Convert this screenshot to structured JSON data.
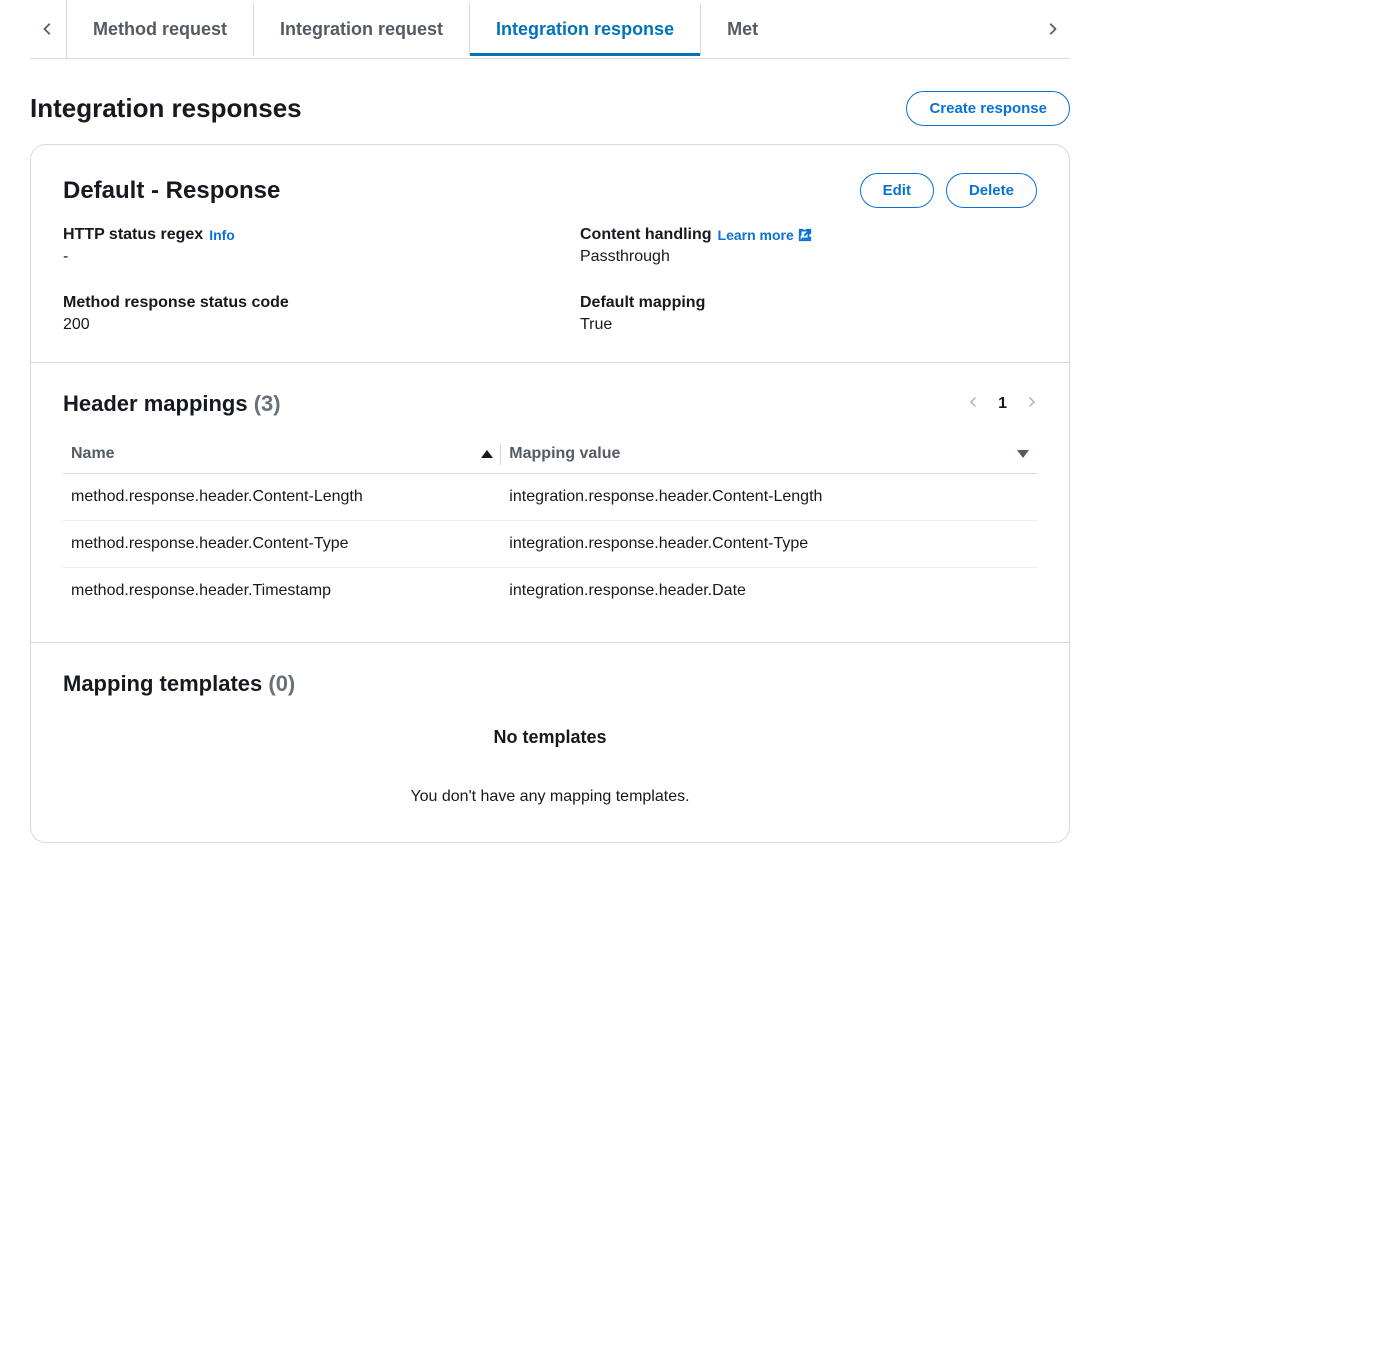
{
  "tabs": {
    "items": [
      {
        "label": "Method request"
      },
      {
        "label": "Integration request"
      },
      {
        "label": "Integration response"
      },
      {
        "label": "Met"
      }
    ],
    "active_index": 2
  },
  "page": {
    "title": "Integration responses",
    "create_label": "Create response"
  },
  "response": {
    "title": "Default - Response",
    "edit_label": "Edit",
    "delete_label": "Delete",
    "details": {
      "http_status_regex": {
        "label": "HTTP status regex",
        "info_label": "Info",
        "value": "-"
      },
      "content_handling": {
        "label": "Content handling",
        "learn_more_label": "Learn more",
        "value": "Passthrough"
      },
      "method_response_status": {
        "label": "Method response status code",
        "value": "200"
      },
      "default_mapping": {
        "label": "Default mapping",
        "value": "True"
      }
    }
  },
  "header_mappings": {
    "title": "Header mappings",
    "count": "(3)",
    "page": "1",
    "columns": {
      "name": "Name",
      "value": "Mapping value"
    },
    "rows": [
      {
        "name": "method.response.header.Content-Length",
        "value": "integration.response.header.Content-Length"
      },
      {
        "name": "method.response.header.Content-Type",
        "value": "integration.response.header.Content-Type"
      },
      {
        "name": "method.response.header.Timestamp",
        "value": "integration.response.header.Date"
      }
    ]
  },
  "mapping_templates": {
    "title": "Mapping templates",
    "count": "(0)",
    "empty_title": "No templates",
    "empty_msg": "You don't have any mapping templates."
  }
}
